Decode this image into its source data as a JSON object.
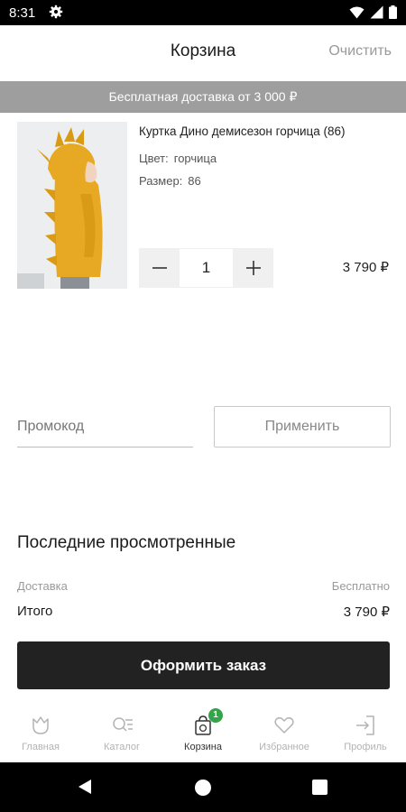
{
  "status_bar": {
    "time": "8:31"
  },
  "header": {
    "title": "Корзина",
    "clear_label": "Очистить"
  },
  "banner": {
    "text": "Бесплатная доставка от 3 000 ₽"
  },
  "cart": {
    "item": {
      "name": "Куртка Дино демисезон горчица (86)",
      "color_label": "Цвет:",
      "color_value": "горчица",
      "size_label": "Размер:",
      "size_value": "86",
      "quantity": "1",
      "price": "3 790 ₽"
    }
  },
  "promo": {
    "placeholder": "Промокод",
    "apply_label": "Применить"
  },
  "recent": {
    "title": "Последние просмотренные"
  },
  "summary": {
    "delivery_label": "Доставка",
    "delivery_value": "Бесплатно",
    "total_label": "Итого",
    "total_value": "3 790 ₽"
  },
  "checkout": {
    "label": "Оформить заказ"
  },
  "nav": {
    "home": "Главная",
    "catalog": "Каталог",
    "cart": "Корзина",
    "cart_badge": "1",
    "favorites": "Избранное",
    "profile": "Профиль"
  },
  "colors": {
    "banner_bg": "#9e9e9e",
    "checkout_bg": "#222222",
    "badge": "#35a34a",
    "jacket": "#e7a824"
  },
  "icons": {
    "status": [
      "gear-icon",
      "wifi-icon",
      "signal-icon",
      "battery-icon"
    ],
    "nav": [
      "tulip-icon",
      "catalog-search-icon",
      "shopping-bag-icon",
      "heart-icon",
      "login-icon"
    ],
    "system": [
      "back-icon",
      "home-icon",
      "recents-icon"
    ]
  }
}
